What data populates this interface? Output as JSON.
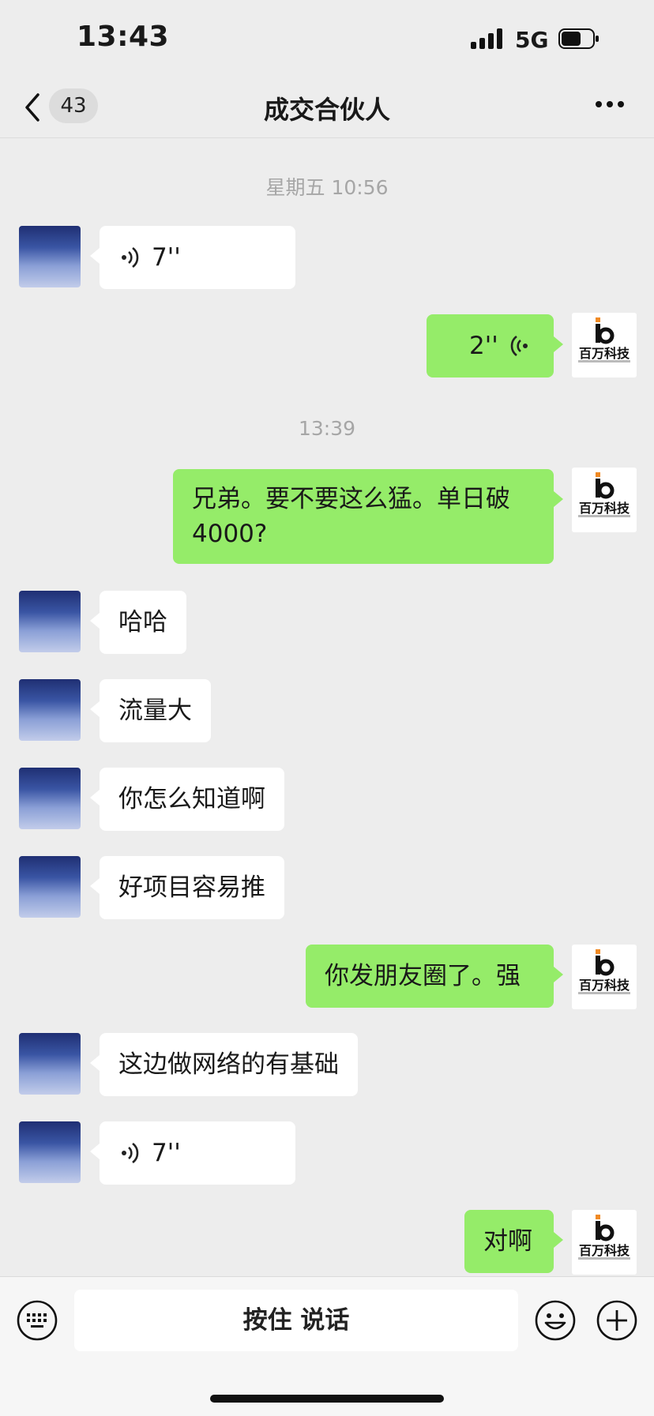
{
  "status_bar": {
    "time": "13:43",
    "network": "5G"
  },
  "nav": {
    "badge_count": "43",
    "title": "成交合伙人"
  },
  "timestamps": [
    "星期五 10:56",
    "13:39"
  ],
  "messages": [
    {
      "side": "in",
      "type": "voice",
      "duration": "7''"
    },
    {
      "side": "out",
      "type": "voice",
      "duration": "2''"
    },
    {
      "side": "out",
      "type": "text",
      "line1": "兄弟。要不要这么猛。单日破",
      "line2": "4000?"
    },
    {
      "side": "in",
      "type": "text",
      "text": "哈哈"
    },
    {
      "side": "in",
      "type": "text",
      "text": "流量大"
    },
    {
      "side": "in",
      "type": "text",
      "text": "你怎么知道啊"
    },
    {
      "side": "in",
      "type": "text",
      "text": "好项目容易推"
    },
    {
      "side": "out",
      "type": "text",
      "text": "你发朋友圈了。强"
    },
    {
      "side": "in",
      "type": "text",
      "text": "这边做网络的有基础"
    },
    {
      "side": "in",
      "type": "voice",
      "duration": "7''"
    },
    {
      "side": "out",
      "type": "text",
      "text": "对啊"
    }
  ],
  "self_avatar": {
    "logo_text": "百万科技",
    "accent_color": "#f08a24"
  },
  "input_bar": {
    "talk_label": "按住 说话"
  },
  "colors": {
    "outgoing_bubble": "#95ec69",
    "incoming_bubble": "#ffffff",
    "background": "#ededed"
  }
}
